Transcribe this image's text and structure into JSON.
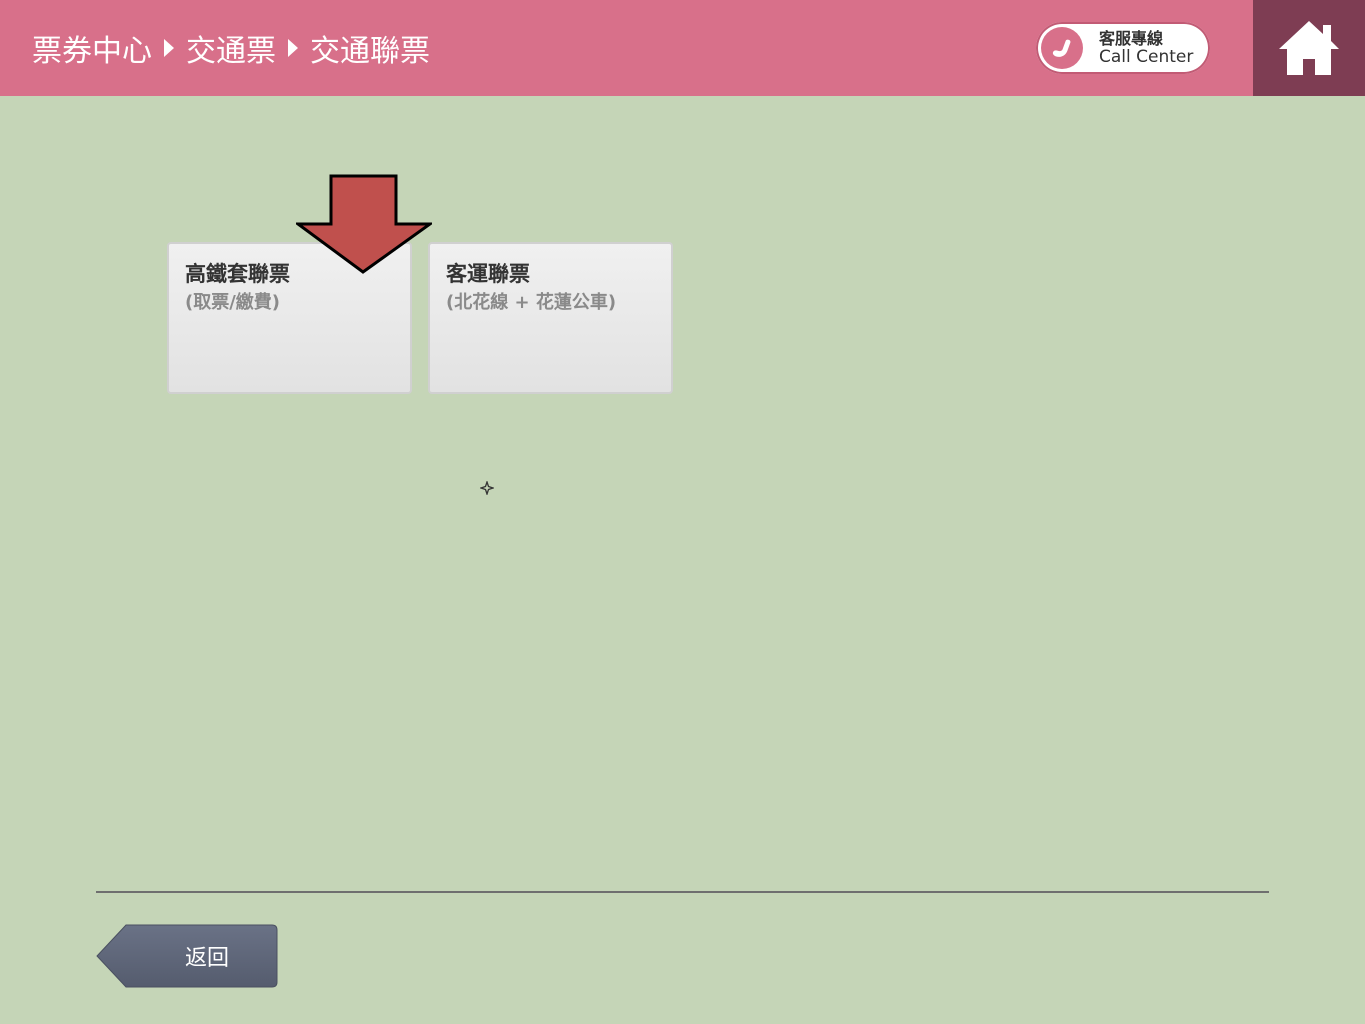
{
  "header": {
    "breadcrumb": [
      "票券中心",
      "交通票",
      "交通聯票"
    ],
    "call_center": {
      "zh": "客服專線",
      "en": "Call Center"
    },
    "home_icon": "home-icon"
  },
  "tiles": [
    {
      "title": "高鐵套聯票",
      "subtitle": "(取票/繳費)"
    },
    {
      "title": "客運聯票",
      "subtitle": "(北花線 + 花蓮公車)"
    }
  ],
  "footer": {
    "back_label": "返回"
  },
  "colors": {
    "header_bg": "#d8708a",
    "home_bg": "#7e3d53",
    "page_bg": "#c5d5b7",
    "arrow": "#c0504d",
    "back_button": "#5f6678"
  }
}
